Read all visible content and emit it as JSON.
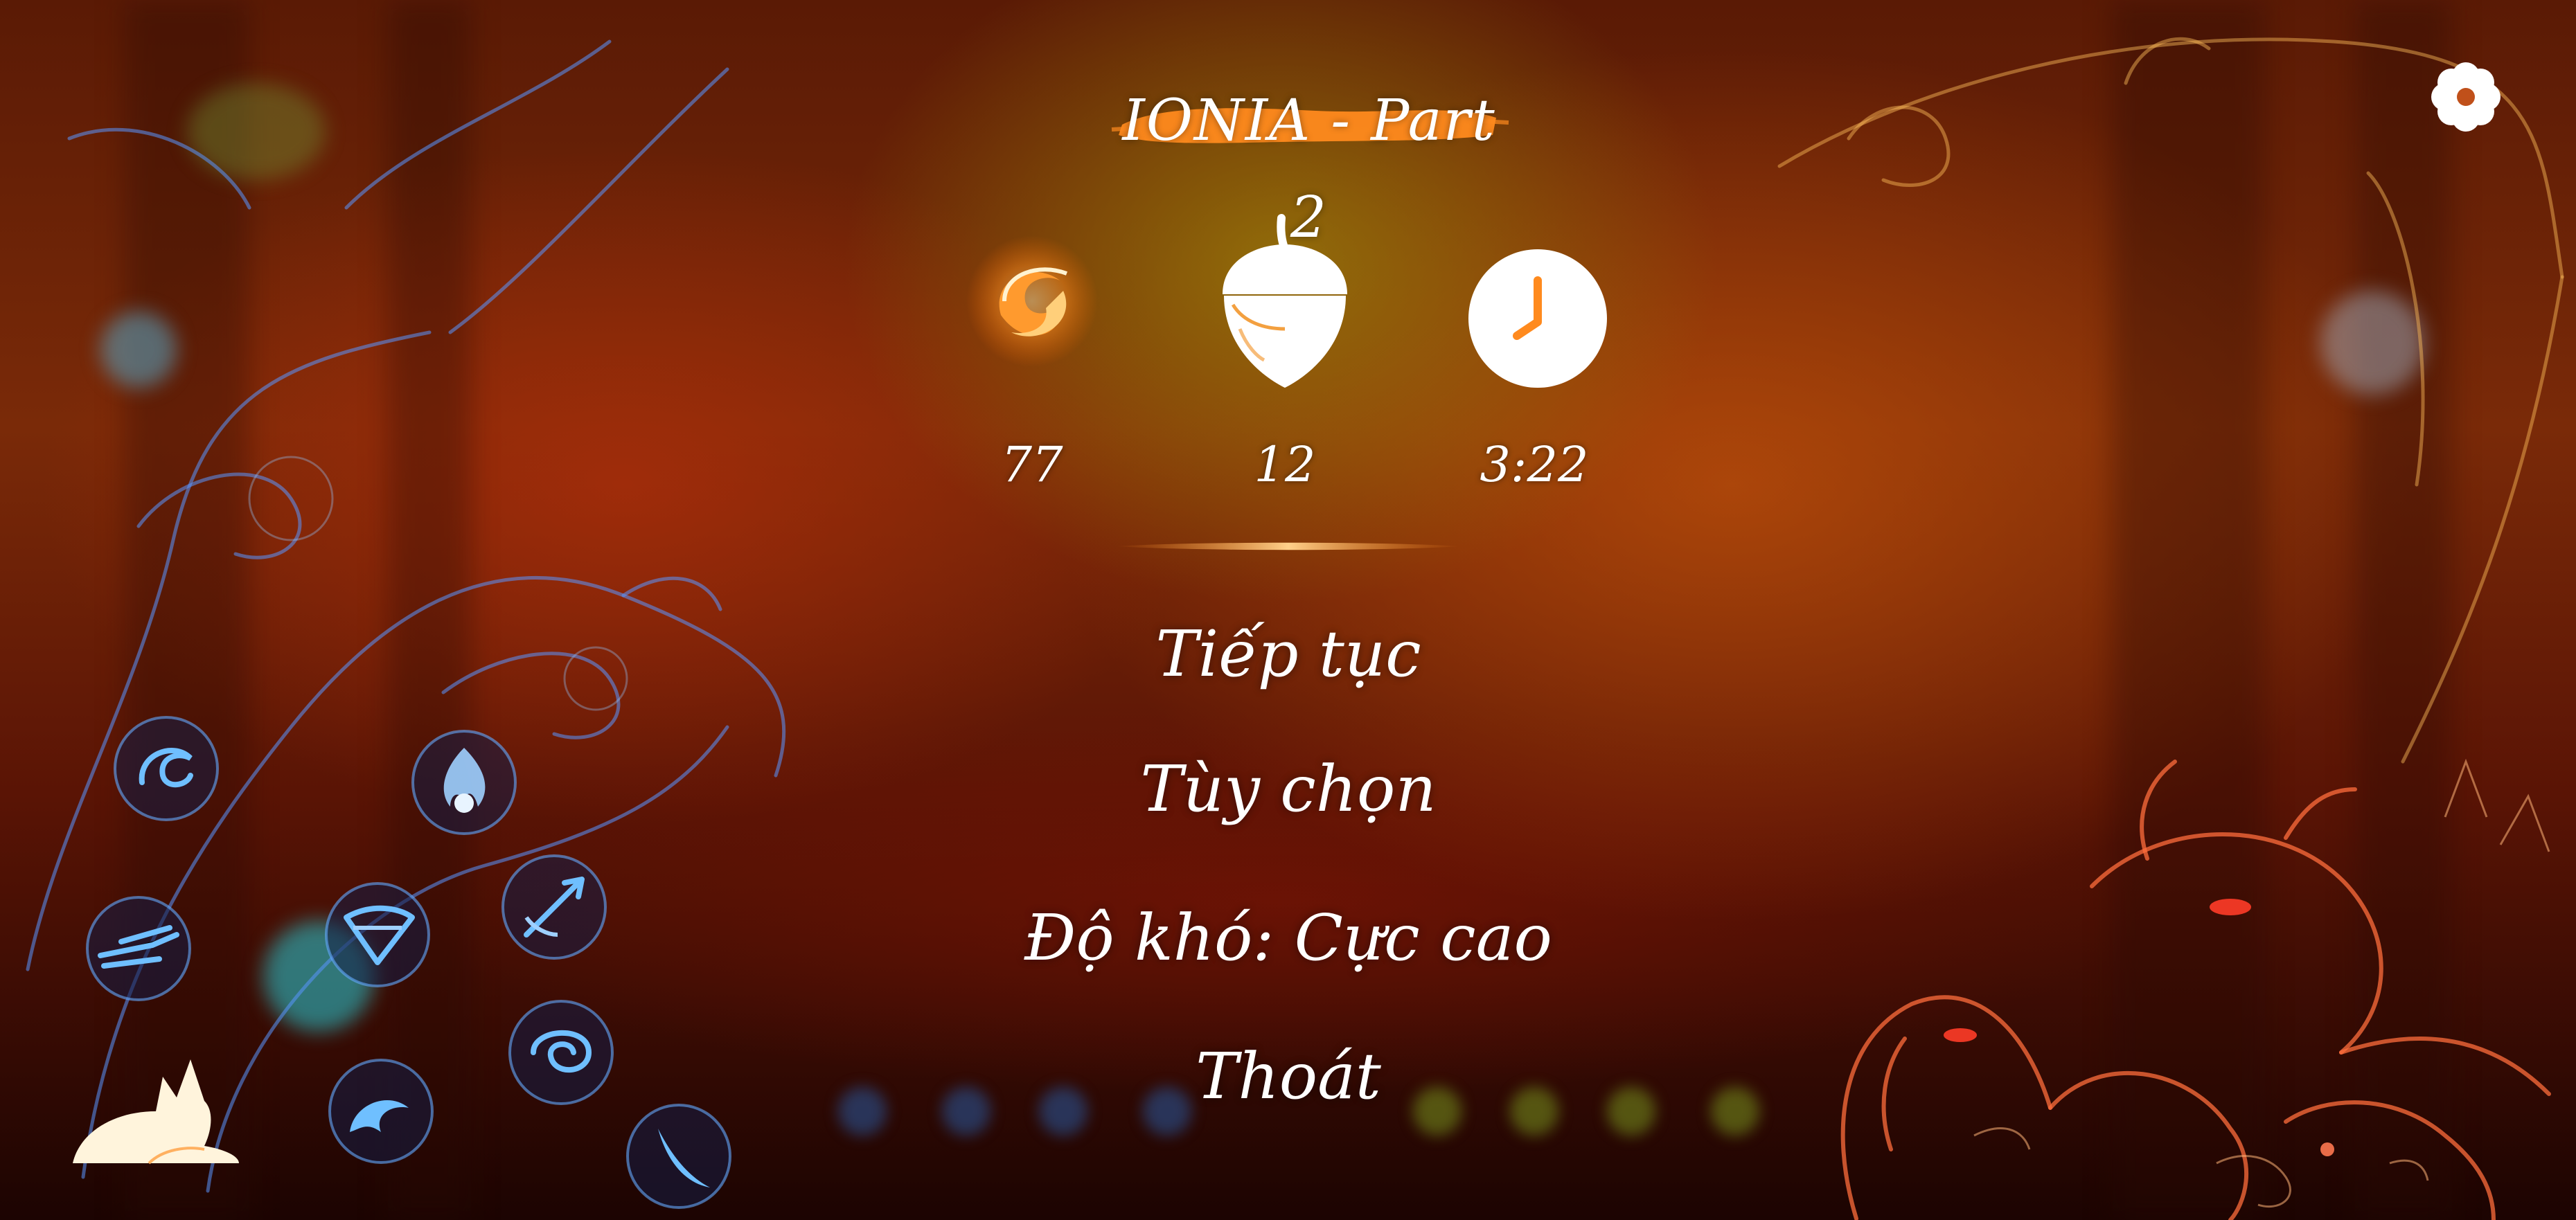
{
  "title": "IONIA - Part 2",
  "stats": {
    "spirit": {
      "icon": "spirit-swirl-icon",
      "value": "77"
    },
    "acorn": {
      "icon": "acorn-icon",
      "value": "12"
    },
    "time": {
      "icon": "clock-icon",
      "value": "3:22"
    }
  },
  "menu": {
    "continue": "Tiếp tục",
    "options": "Tùy chọn",
    "difficulty": "Độ khó: Cực cao",
    "quit": "Thoát"
  },
  "settings": {
    "icon": "gear-icon"
  },
  "skills": [
    {
      "icon": "wind-swirl-skill-icon"
    },
    {
      "icon": "flame-skill-icon"
    },
    {
      "icon": "dash-skill-icon"
    },
    {
      "icon": "bow-skill-icon"
    },
    {
      "icon": "arrow-burst-skill-icon"
    },
    {
      "icon": "vortex-skill-icon"
    },
    {
      "icon": "wave-skill-icon"
    },
    {
      "icon": "feather-skill-icon"
    }
  ],
  "colors": {
    "accent_orange": "#ff8a1e",
    "skill_blue": "#3fa8ff",
    "text": "#ffffff"
  }
}
